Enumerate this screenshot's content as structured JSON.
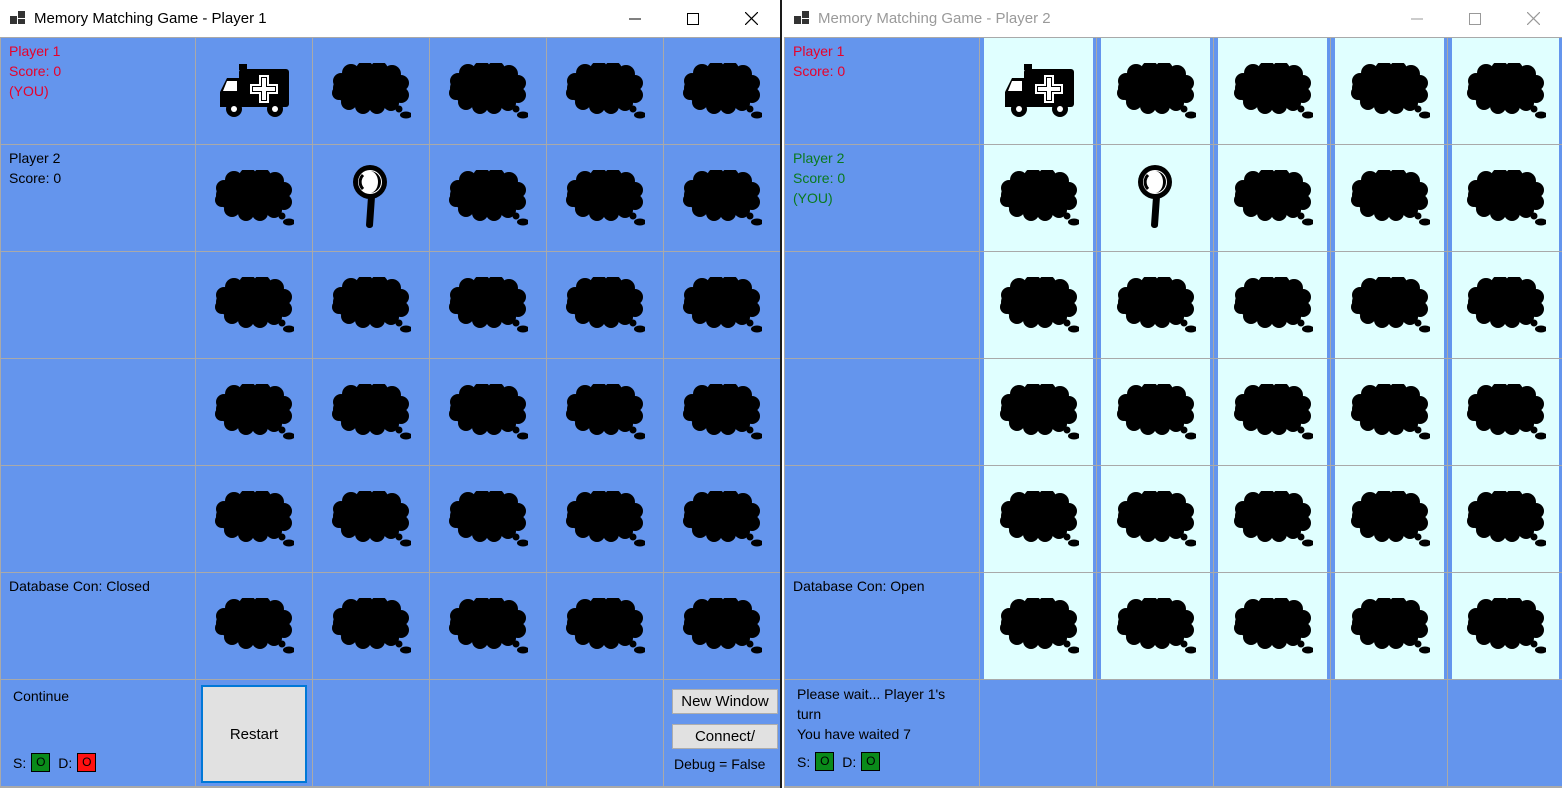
{
  "window1": {
    "title": "Memory Matching Game - Player 1",
    "player1": {
      "label": "Player 1",
      "score": "Score: 0",
      "you": "(YOU)"
    },
    "player2": {
      "label": "Player 2",
      "score": "Score: 0"
    },
    "database": "Database Con: Closed",
    "status": "Continue",
    "s_label": "S:",
    "d_label": "D:",
    "s_value": "O",
    "d_value": "O",
    "restart_label": "Restart",
    "new_window_label": "New Window",
    "connect_label": "Connect/",
    "debug_label": "Debug = False"
  },
  "window2": {
    "title": "Memory Matching Game - Player 2",
    "player1": {
      "label": "Player 1",
      "score": "Score: 0"
    },
    "player2": {
      "label": "Player 2",
      "score": "Score: 0",
      "you": "(YOU)"
    },
    "database": "Database Con: Open",
    "status_line1": "Please wait... Player 1's",
    "status_line2": "turn",
    "status_line3": "You have waited 7",
    "s_label": "S:",
    "d_label": "D:",
    "s_value": "O",
    "d_value": "O"
  },
  "board": {
    "rows": 6,
    "cols": 5,
    "revealed": [
      {
        "row": 0,
        "col": 0,
        "icon": "ambulance-icon"
      },
      {
        "row": 1,
        "col": 1,
        "icon": "magnifier-icon"
      }
    ],
    "hidden_icon": "thought-bubble-icon"
  },
  "colors": {
    "panel_blue": "#6495ed",
    "card_bg_p2": "#e0ffff",
    "player1_red": "#e8002a",
    "player2_green": "#0a7a1e",
    "led_green": "#0a8a1a",
    "led_red": "#ff1010"
  }
}
